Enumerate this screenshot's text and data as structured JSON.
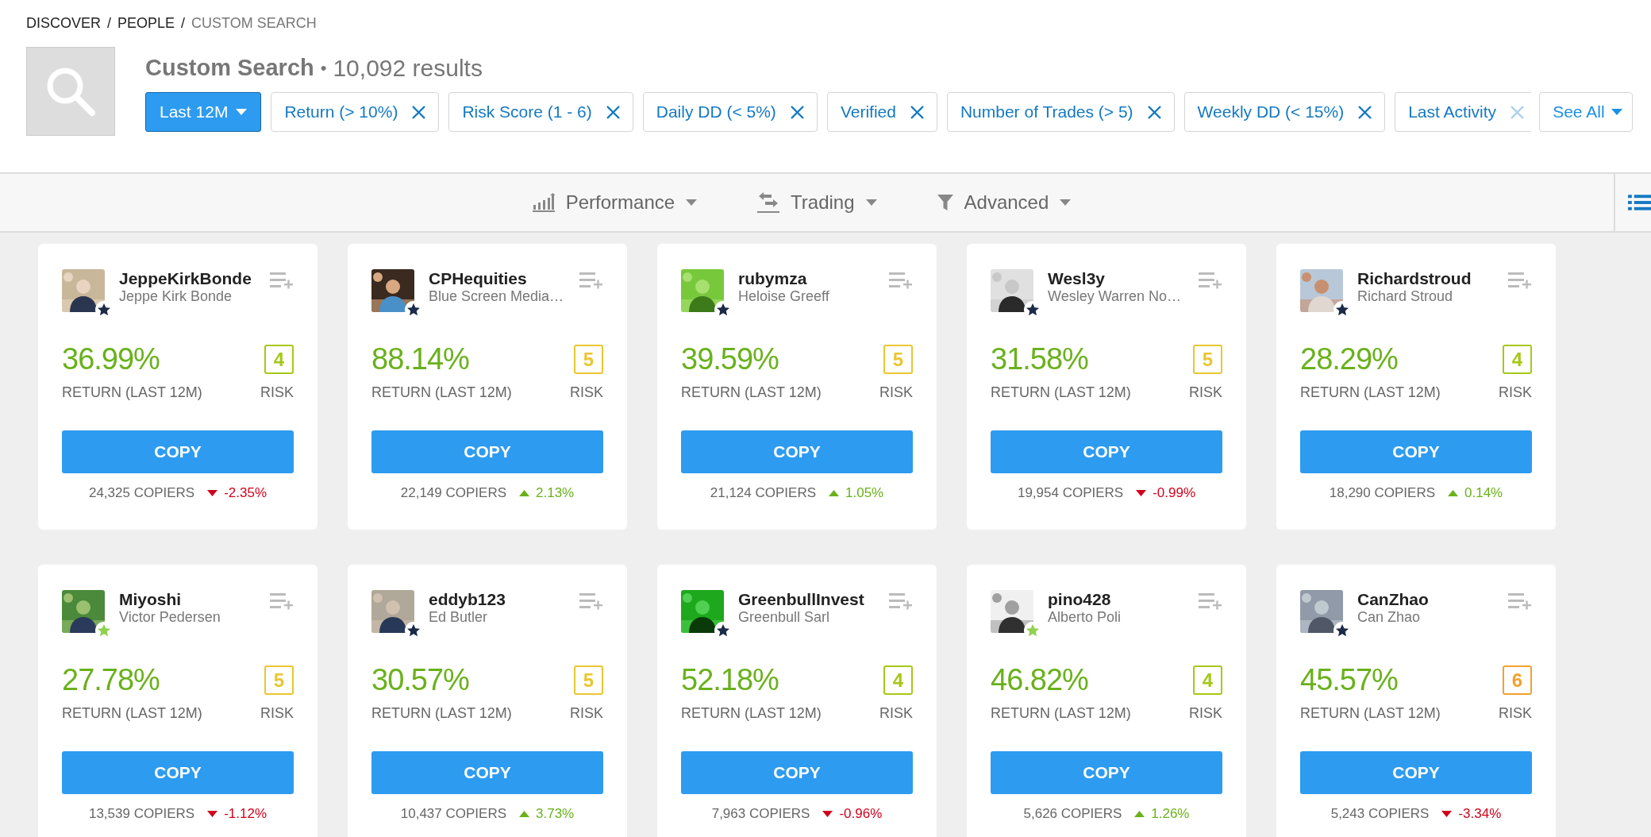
{
  "breadcrumb": [
    {
      "label": "DISCOVER",
      "current": false
    },
    {
      "label": "PEOPLE",
      "current": false
    },
    {
      "label": "CUSTOM SEARCH",
      "current": true
    }
  ],
  "breadcrumb_separator": "/",
  "header": {
    "title": "Custom Search",
    "separator": "•",
    "results": "10,092 results"
  },
  "period": {
    "label": "Last 12M"
  },
  "filters": [
    {
      "label": "Return (> 10%)",
      "cut": false
    },
    {
      "label": "Risk Score (1 - 6)",
      "cut": false
    },
    {
      "label": "Daily DD (< 5%)",
      "cut": false
    },
    {
      "label": "Verified",
      "cut": false
    },
    {
      "label": "Number of Trades (> 5)",
      "cut": false
    },
    {
      "label": "Weekly DD (< 15%)",
      "cut": false
    },
    {
      "label": "Last Activity",
      "cut": true
    }
  ],
  "see_all": {
    "label": "See All"
  },
  "toolbar": [
    {
      "kind": "performance",
      "label": "Performance"
    },
    {
      "kind": "trading",
      "label": "Trading"
    },
    {
      "kind": "advanced",
      "label": "Advanced"
    }
  ],
  "cards": [
    {
      "username": "JeppeKirkBonde",
      "fullname": "Jeppe Kirk Bonde",
      "color": "#1b2a47",
      "return": "36.99%",
      "return_label": "RETURN (LAST 12M)",
      "risk": "4",
      "risk_label": "RISK",
      "button": "COPY",
      "copiers": "24,325 COPIERS",
      "rising": false,
      "change": "-2.35%"
    },
    {
      "username": "CPHequities",
      "fullname": "Blue Screen Media…",
      "color": "#1b2a47",
      "return": "88.14%",
      "return_label": "RETURN (LAST 12M)",
      "risk": "5",
      "risk_label": "RISK",
      "button": "COPY",
      "copiers": "22,149 COPIERS",
      "rising": true,
      "change": "2.13%"
    },
    {
      "username": "rubymza",
      "fullname": "Heloise Greeff",
      "color": "#1b2a47",
      "return": "39.59%",
      "return_label": "RETURN (LAST 12M)",
      "risk": "5",
      "risk_label": "RISK",
      "button": "COPY",
      "copiers": "21,124 COPIERS",
      "rising": true,
      "change": "1.05%"
    },
    {
      "username": "Wesl3y",
      "fullname": "Wesley Warren No…",
      "color": "#1b2a47",
      "return": "31.58%",
      "return_label": "RETURN (LAST 12M)",
      "risk": "5",
      "risk_label": "RISK",
      "button": "COPY",
      "copiers": "19,954 COPIERS",
      "rising": false,
      "change": "-0.99%"
    },
    {
      "username": "Richardstroud",
      "fullname": "Richard Stroud",
      "color": "#1b2a47",
      "return": "28.29%",
      "return_label": "RETURN (LAST 12M)",
      "risk": "4",
      "risk_label": "RISK",
      "button": "COPY",
      "copiers": "18,290 COPIERS",
      "rising": true,
      "change": "0.14%"
    },
    {
      "username": "Miyoshi",
      "fullname": "Victor Pedersen",
      "color": "#8fd14f",
      "return": "27.78%",
      "return_label": "RETURN (LAST 12M)",
      "risk": "5",
      "risk_label": "RISK",
      "button": "COPY",
      "copiers": "13,539 COPIERS",
      "rising": false,
      "change": "-1.12%"
    },
    {
      "username": "eddyb123",
      "fullname": "Ed Butler",
      "color": "#1b2a47",
      "return": "30.57%",
      "return_label": "RETURN (LAST 12M)",
      "risk": "5",
      "risk_label": "RISK",
      "button": "COPY",
      "copiers": "10,437 COPIERS",
      "rising": true,
      "change": "3.73%"
    },
    {
      "username": "GreenbullInvest",
      "fullname": "Greenbull Sarl",
      "color": "#1b2a47",
      "return": "52.18%",
      "return_label": "RETURN (LAST 12M)",
      "risk": "4",
      "risk_label": "RISK",
      "button": "COPY",
      "copiers": "7,963 COPIERS",
      "rising": false,
      "change": "-0.96%"
    },
    {
      "username": "pino428",
      "fullname": "Alberto Poli",
      "color": "#8fd14f",
      "return": "46.82%",
      "return_label": "RETURN (LAST 12M)",
      "risk": "4",
      "risk_label": "RISK",
      "button": "COPY",
      "copiers": "5,626 COPIERS",
      "rising": true,
      "change": "1.26%"
    },
    {
      "username": "CanZhao",
      "fullname": "Can Zhao",
      "color": "#1b2a47",
      "return": "45.57%",
      "return_label": "RETURN (LAST 12M)",
      "risk": "6",
      "risk_label": "RISK",
      "button": "COPY",
      "copiers": "5,243 COPIERS",
      "rising": false,
      "change": "-3.34%"
    }
  ]
}
